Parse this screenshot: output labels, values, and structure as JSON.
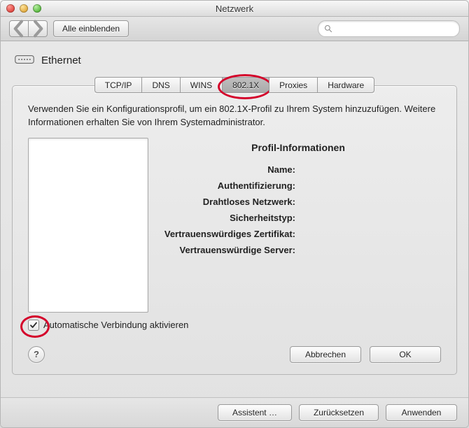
{
  "window": {
    "title": "Netzwerk"
  },
  "toolbar": {
    "show_all": "Alle einblenden",
    "search_placeholder": ""
  },
  "service": {
    "name": "Ethernet"
  },
  "tabs": {
    "items": [
      {
        "label": "TCP/IP"
      },
      {
        "label": "DNS"
      },
      {
        "label": "WINS"
      },
      {
        "label": "802.1X",
        "selected": true
      },
      {
        "label": "Proxies"
      },
      {
        "label": "Hardware"
      }
    ]
  },
  "sheet": {
    "instructions": "Verwenden Sie ein Konfigurationsprofil, um ein 802.1X-Profil zu Ihrem System hinzuzufügen. Weitere Informationen erhalten Sie von Ihrem Systemadministrator.",
    "info_title": "Profil-Informationen",
    "fields": {
      "name": {
        "label": "Name:",
        "value": ""
      },
      "auth": {
        "label": "Authentifizierung:",
        "value": ""
      },
      "wifi": {
        "label": "Drahtloses Netzwerk:",
        "value": ""
      },
      "sectype": {
        "label": "Sicherheitstyp:",
        "value": ""
      },
      "cert": {
        "label": "Vertrauenswürdiges Zertifikat:",
        "value": ""
      },
      "servers": {
        "label": "Vertrauenswürdige Server:",
        "value": ""
      }
    },
    "auto_connect": {
      "label": "Automatische Verbindung aktivieren",
      "checked": true
    },
    "help": "?",
    "cancel": "Abbrechen",
    "ok": "OK"
  },
  "footer": {
    "assistant": "Assistent …",
    "revert": "Zurücksetzen",
    "apply": "Anwenden"
  }
}
